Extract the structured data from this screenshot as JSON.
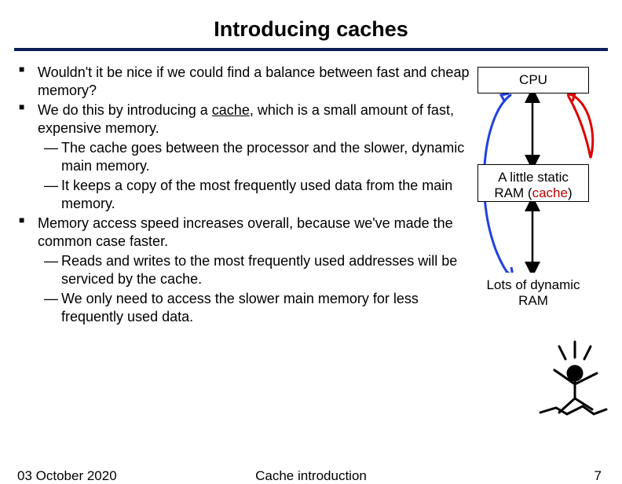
{
  "title": "Introducing caches",
  "bullets": {
    "b1": "Wouldn't it be nice if we could find a balance between fast and cheap memory?",
    "b2a": "We do this by introducing a ",
    "b2_u": "cache",
    "b2b": ", which is a small amount of fast, expensive memory.",
    "b2s1": "The cache goes between the processor and the slower, dynamic main memory.",
    "b2s2": "It keeps a copy of the most frequently used data from the main memory.",
    "b3": "Memory access speed increases overall, because we've made the common case faster.",
    "b3s1": "Reads and writes to the most frequently used addresses will be serviced by the cache.",
    "b3s2": "We only need to access the slower main memory for less frequently used data."
  },
  "diagram": {
    "cpu": "CPU",
    "cache_a": "A little static RAM (",
    "cache_red": "cache",
    "cache_b": ")",
    "dram": "Lots of dynamic RAM"
  },
  "footer": {
    "date": "03 October 2020",
    "center": "Cache introduction",
    "page": "7"
  }
}
